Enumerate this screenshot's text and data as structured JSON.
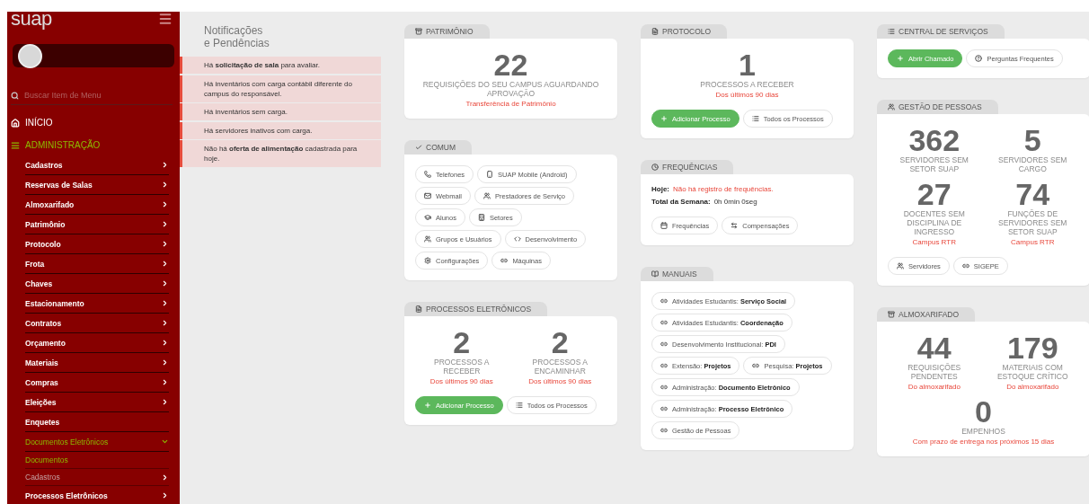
{
  "sidebar": {
    "logo": "suap",
    "search": {
      "placeholder": "Buscar Item de Menu"
    },
    "menu": [
      {
        "label": "INÍCIO",
        "expanded": false
      },
      {
        "label": "ADMINISTRAÇÃO",
        "expanded": true,
        "children": [
          {
            "label": "Cadastros",
            "kind": "folder",
            "expanded": false
          },
          {
            "label": "Reservas de Salas",
            "kind": "folder",
            "expanded": false
          },
          {
            "label": "Almoxarifado",
            "kind": "folder",
            "expanded": false
          },
          {
            "label": "Patrimônio",
            "kind": "folder",
            "expanded": false
          },
          {
            "label": "Protocolo",
            "kind": "folder",
            "expanded": false
          },
          {
            "label": "Frota",
            "kind": "folder",
            "expanded": false
          },
          {
            "label": "Chaves",
            "kind": "folder",
            "expanded": false
          },
          {
            "label": "Estacionamento",
            "kind": "folder",
            "expanded": false
          },
          {
            "label": "Contratos",
            "kind": "folder",
            "expanded": false
          },
          {
            "label": "Orçamento",
            "kind": "folder",
            "expanded": false
          },
          {
            "label": "Materiais",
            "kind": "folder",
            "expanded": false
          },
          {
            "label": "Compras",
            "kind": "folder",
            "expanded": false
          },
          {
            "label": "Eleições",
            "kind": "folder",
            "expanded": false
          },
          {
            "label": "Enquetes",
            "kind": "link",
            "expanded": false
          },
          {
            "label": "Documentos Eletrônicos",
            "kind": "folder",
            "expanded": true,
            "children": [
              {
                "label": "Documentos",
                "kind": "link",
                "selected": true
              },
              {
                "label": "Cadastros",
                "kind": "folder",
                "selected": false
              }
            ]
          },
          {
            "label": "Processos Eletrônicos",
            "kind": "folder",
            "expanded": false
          }
        ]
      }
    ]
  },
  "notifications": {
    "title": "Notificações e Pendências",
    "items": [
      "Há **solicitação de sala** para avaliar.",
      "Há inventários com carga contábil diferente do campus do responsável.",
      "Há inventários sem carga.",
      "Há servidores inativos com carga.",
      "Não há **oferta de alimentação** cadastrada para hoje."
    ]
  },
  "columns": [
    [
      {
        "title": "PATRIMÔNIO",
        "blocks": [
          {
            "kind": "stats",
            "items": [
              {
                "value": "22",
                "label": "REQUISIÇÕES DO SEU CAMPUS AGUARDANDO APROVAÇÃO",
                "note": "Transferência de Patrimônio"
              }
            ]
          }
        ]
      },
      {
        "title": "COMUM",
        "blocks": [
          {
            "kind": "buttons",
            "items": [
              {
                "label": "Telefones",
                "kind": "default"
              },
              {
                "label": "SUAP Mobile (Android)",
                "kind": "default"
              },
              {
                "label": "Webmail",
                "kind": "default"
              },
              {
                "label": "Prestadores de Serviço",
                "kind": "default"
              },
              {
                "label": "Alunos",
                "kind": "default"
              },
              {
                "label": "Setores",
                "kind": "default"
              },
              {
                "label": "Grupos e Usuários",
                "kind": "default"
              },
              {
                "label": "Desenvolvimento",
                "kind": "default"
              },
              {
                "label": "Configurações",
                "kind": "default"
              },
              {
                "label": "Máquinas",
                "kind": "default"
              }
            ]
          }
        ]
      },
      {
        "title": "PROCESSOS ELETRÔNICOS",
        "blocks": [
          {
            "kind": "stats",
            "items": [
              {
                "value": "2",
                "label": "PROCESSOS A RECEBER",
                "note": "Dos últimos 90 dias"
              },
              {
                "value": "2",
                "label": "PROCESSOS A ENCAMINHAR",
                "note": "Dos últimos 90 dias"
              }
            ]
          },
          {
            "kind": "buttons",
            "items": [
              {
                "label": "Adicionar Processo",
                "kind": "primary"
              },
              {
                "label": "Todos os Processos",
                "kind": "default"
              }
            ]
          }
        ]
      }
    ],
    [
      {
        "title": "PROTOCOLO",
        "blocks": [
          {
            "kind": "stats",
            "items": [
              {
                "value": "1",
                "label": "PROCESSOS A RECEBER",
                "note": "Dos últimos 90 dias"
              }
            ]
          },
          {
            "kind": "buttons",
            "items": [
              {
                "label": "Adicionar Processo",
                "kind": "primary"
              },
              {
                "label": "Todos os Processos",
                "kind": "default"
              }
            ]
          }
        ]
      },
      {
        "title": "FREQUÊNCIAS",
        "blocks": [
          {
            "kind": "info",
            "lines": [
              {
                "label": "Hoje:",
                "value": "Não há registro de frequências.",
                "alert": true
              },
              {
                "label": "Total da Semana:",
                "value": "0h 0min 0seg",
                "alert": false
              }
            ]
          },
          {
            "kind": "buttons",
            "items": [
              {
                "label": "Frequências",
                "kind": "default"
              },
              {
                "label": "Compensações",
                "kind": "default"
              }
            ]
          }
        ]
      },
      {
        "title": "MANUAIS",
        "blocks": [
          {
            "kind": "buttons",
            "items": [
              {
                "label": "Atividades Estudantis: **Serviço Social**",
                "kind": "default"
              },
              {
                "label": "Atividades Estudantis: **Coordenação**",
                "kind": "default"
              },
              {
                "label": "Desenvolvimento Institucional: **PDI**",
                "kind": "default"
              },
              {
                "label": "Extensão: **Projetos**",
                "kind": "default"
              },
              {
                "label": "Pesquisa: **Projetos**",
                "kind": "default"
              },
              {
                "label": "Administração: **Documento Eletrônico**",
                "kind": "default"
              },
              {
                "label": "Administração: **Processo Eletrônico**",
                "kind": "default"
              },
              {
                "label": "Gestão de Pessoas",
                "kind": "default"
              }
            ]
          }
        ]
      }
    ],
    [
      {
        "title": "CENTRAL DE SERVIÇOS",
        "blocks": [
          {
            "kind": "buttons",
            "items": [
              {
                "label": "Abrir Chamado",
                "kind": "primary"
              },
              {
                "label": "Perguntas Frequentes",
                "kind": "default"
              }
            ]
          }
        ]
      },
      {
        "title": "GESTÃO DE PESSOAS",
        "blocks": [
          {
            "kind": "stats",
            "items": [
              {
                "value": "362",
                "label": "SERVIDORES SEM SETOR SUAP"
              },
              {
                "value": "5",
                "label": "SERVIDORES SEM CARGO"
              },
              {
                "value": "27",
                "label": "DOCENTES SEM DISCIPLINA DE INGRESSO",
                "note": "Campus RTR"
              },
              {
                "value": "74",
                "label": "FUNÇÕES DE SERVIDORES SEM SETOR SUAP",
                "note": "Campus RTR"
              }
            ]
          },
          {
            "kind": "buttons",
            "items": [
              {
                "label": "Servidores",
                "kind": "default"
              },
              {
                "label": "SIGEPE",
                "kind": "default"
              }
            ]
          }
        ]
      },
      {
        "title": "ALMOXARIFADO",
        "blocks": [
          {
            "kind": "stats",
            "items": [
              {
                "value": "44",
                "label": "REQUISIÇÕES PENDENTES",
                "note": "Do almoxarifado"
              },
              {
                "value": "179",
                "label": "MATERIAIS COM ESTOQUE CRÍTICO",
                "note": "Do almoxarifado"
              },
              {
                "value": "0",
                "label": "EMPENHOS",
                "note": "Com prazo de entrega nos próximos 15 dias"
              }
            ]
          }
        ]
      }
    ]
  ]
}
